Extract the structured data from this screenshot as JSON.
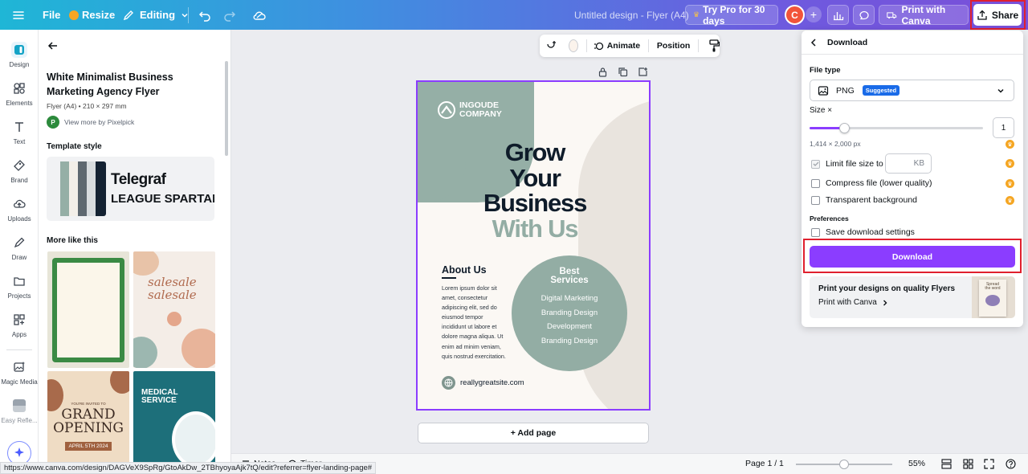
{
  "topbar": {
    "menu_icon": "hamburger-menu-icon",
    "file": "File",
    "resize": "Resize",
    "editing": "Editing",
    "doc_title": "Untitled design - Flyer (A4)",
    "try_pro": "Try Pro for 30 days",
    "avatar_letter": "C",
    "print_with_canva": "Print with Canva",
    "share": "Share",
    "colors": {
      "accent": "#8b3dff",
      "highlight": "#e0202e"
    }
  },
  "rail": {
    "items": [
      {
        "label": "Design",
        "icon": "design-icon"
      },
      {
        "label": "Elements",
        "icon": "elements-icon"
      },
      {
        "label": "Text",
        "icon": "text-icon"
      },
      {
        "label": "Brand",
        "icon": "brand-icon"
      },
      {
        "label": "Uploads",
        "icon": "uploads-icon"
      },
      {
        "label": "Draw",
        "icon": "draw-icon"
      },
      {
        "label": "Projects",
        "icon": "projects-icon"
      },
      {
        "label": "Apps",
        "icon": "apps-icon"
      },
      {
        "label": "Magic Media",
        "icon": "magic-media-icon"
      },
      {
        "label": "Easy Refle...",
        "icon": "easy-reflections-icon"
      }
    ]
  },
  "panel": {
    "title": "White Minimalist Business Marketing Agency Flyer",
    "meta": "Flyer (A4) • 210 × 297 mm",
    "creator_initial": "P",
    "creator": "View more by Pixelpick",
    "template_style": "Template style",
    "font_1": "Telegraf",
    "font_2": "LEAGUE SPARTAN",
    "more_like_this": "More like this",
    "thumbs": {
      "sale": "sale",
      "grand_1": "YOU'RE INVITED TO",
      "grand_2": "GRAND",
      "grand_3": "OPENING",
      "grand_date": "APRIL 5TH 2024",
      "medical_1": "MEDICAL",
      "medical_2": "SERVICE"
    }
  },
  "toolbar": {
    "animate": "Animate",
    "position": "Position"
  },
  "flyer": {
    "logo_1": "INGOUDE",
    "logo_2": "COMPANY",
    "head_1": "Grow",
    "head_2": "Your",
    "head_3": "Business",
    "head_4": "With Us",
    "about": "About Us",
    "body": "Lorem ipsum dolor sit amet, consectetur adipiscing elit, sed do eiusmod tempor incididunt ut labore et dolore magna aliqua. Ut enim ad minim veniam, quis nostrud exercitation.",
    "services_title_1": "Best",
    "services_title_2": "Services",
    "services": [
      "Digital Marketing",
      "Branding Design",
      "Development",
      "Branding Design"
    ],
    "site": "reallygreatsite.com"
  },
  "add_page": "+ Add page",
  "download": {
    "header": "Download",
    "file_type_label": "File type",
    "file_type": "PNG",
    "suggested": "Suggested",
    "size_label": "Size ×",
    "size_value": "1",
    "size_fraction": 0.2,
    "dimensions": "1,414 × 2,000 px",
    "limit_file_size": "Limit file size to",
    "kb": "KB",
    "compress": "Compress file (lower quality)",
    "transparent": "Transparent background",
    "preferences": "Preferences",
    "save_settings": "Save download settings",
    "button": "Download",
    "promo_title": "Print your designs on quality Flyers",
    "promo_link": "Print with Canva",
    "promo_card_1": "Spread",
    "promo_card_2": "the word"
  },
  "bottombar": {
    "notes": "Notes",
    "timer": "Timer",
    "page_indicator": "Page 1 / 1",
    "zoom_fraction": 0.5,
    "zoom": "55%"
  },
  "status_url": "https://www.canva.com/design/DAGVeX9SpRg/GtoAkDw_2TBhyoyaAjk7tQ/edit?referrer=flyer-landing-page#"
}
